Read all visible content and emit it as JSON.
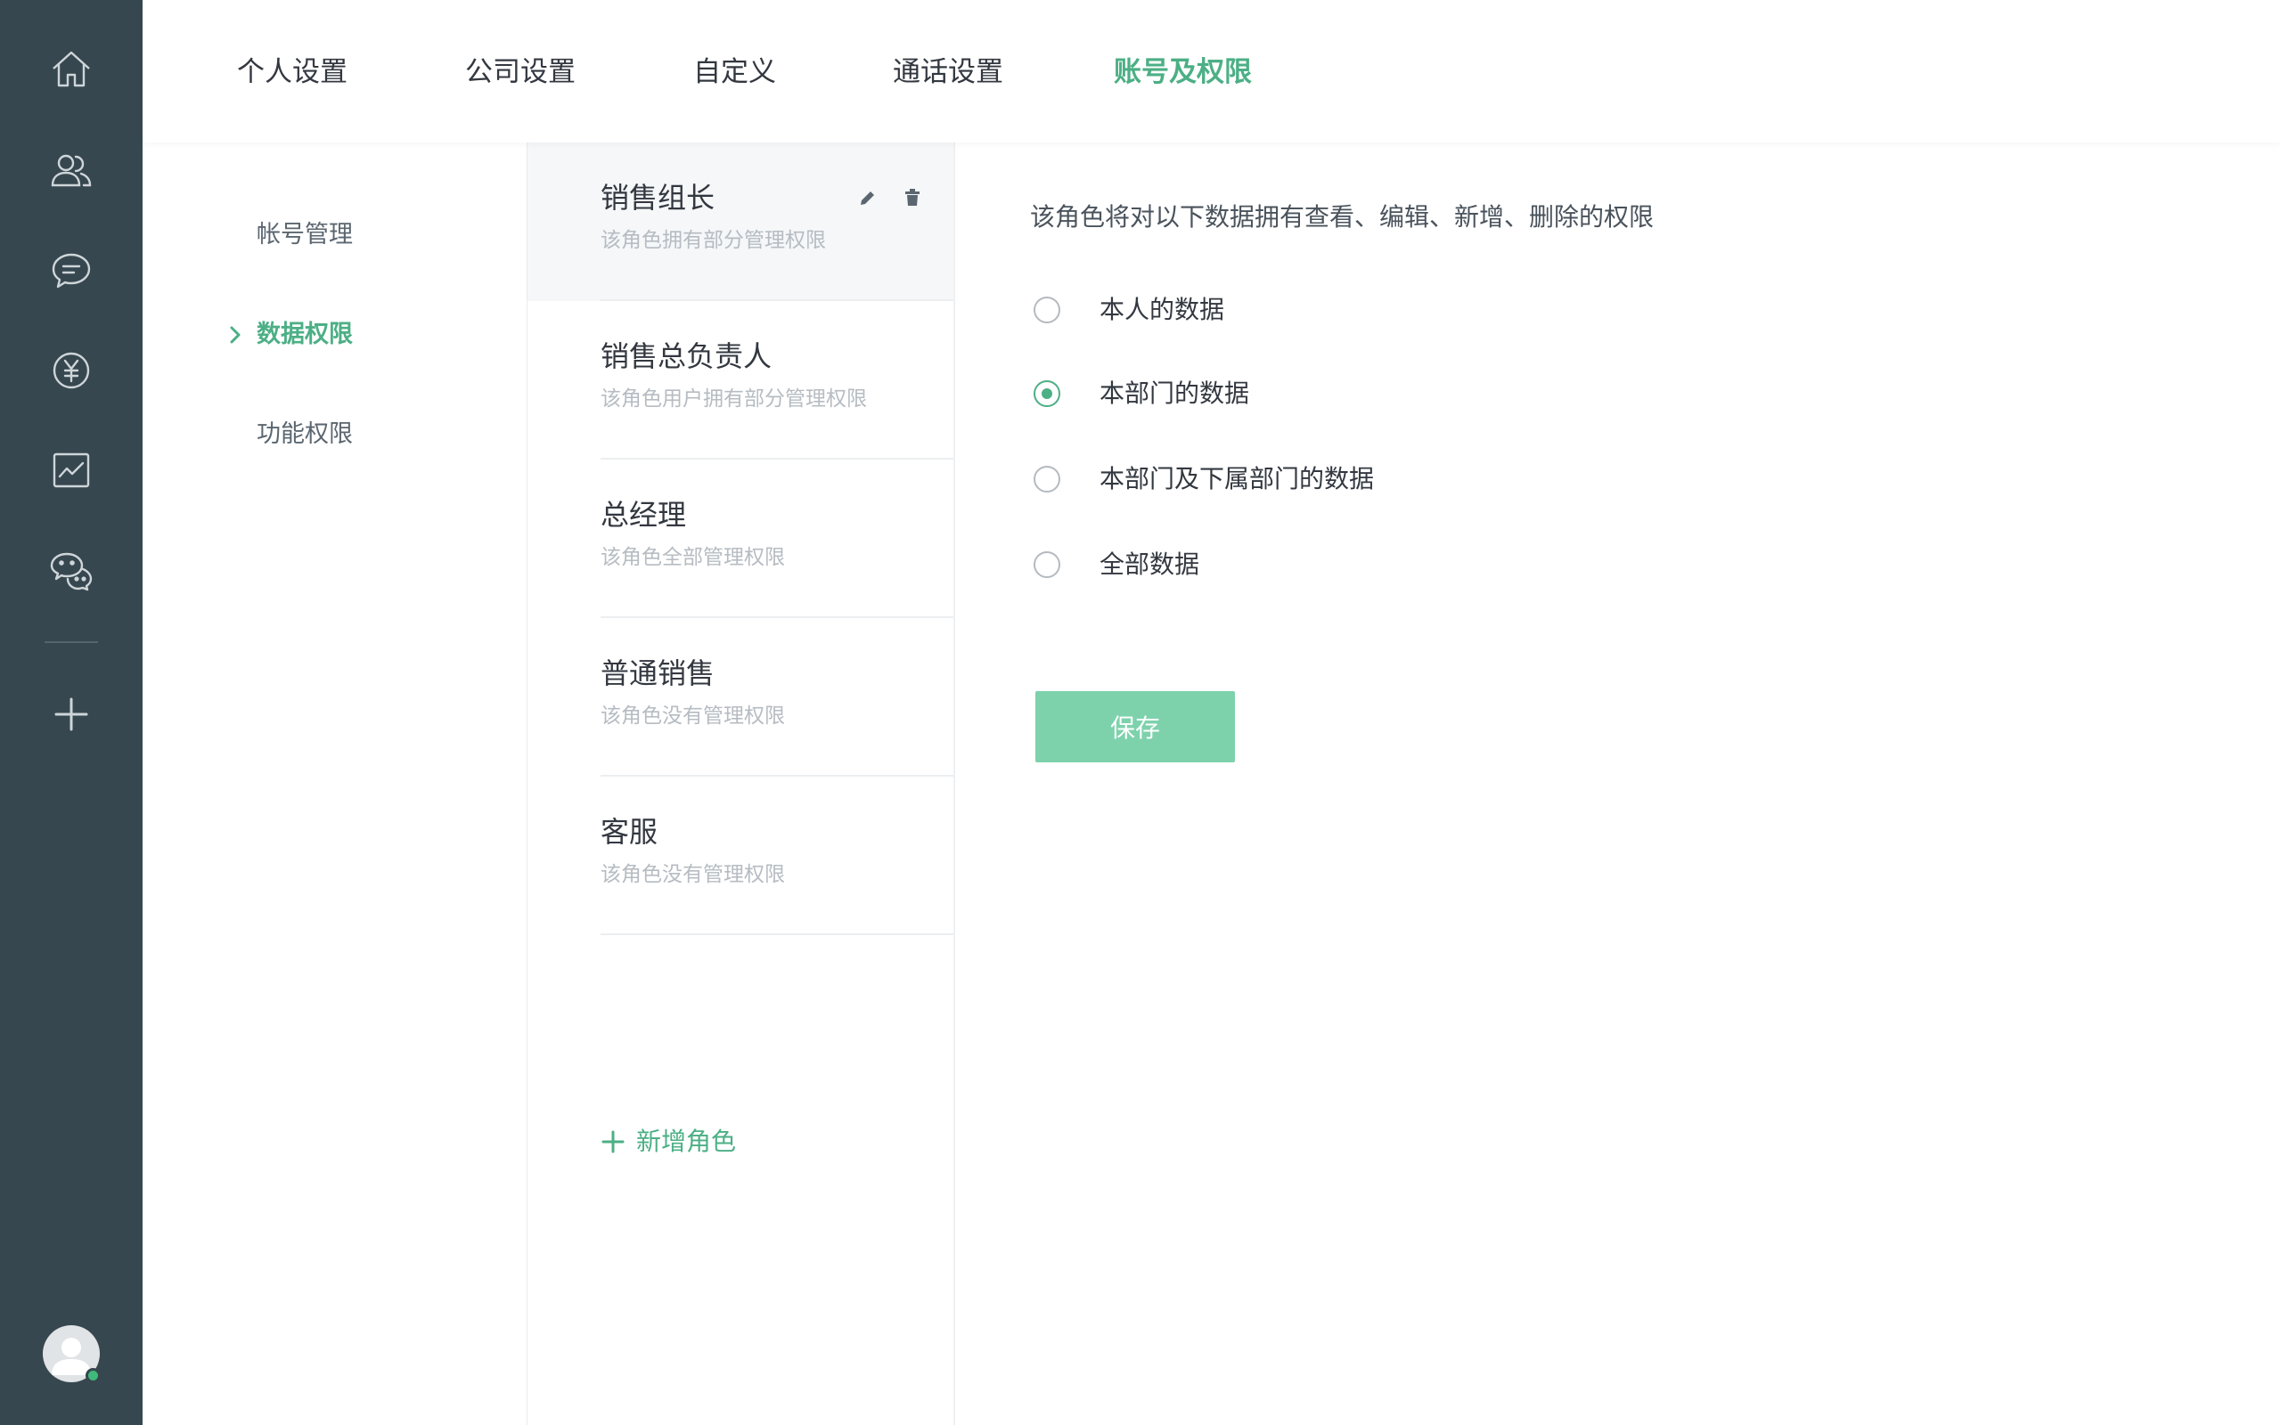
{
  "rail": {
    "icons": [
      {
        "name": "home-icon"
      },
      {
        "name": "contacts-icon"
      },
      {
        "name": "chat-icon"
      },
      {
        "name": "yuan-icon"
      },
      {
        "name": "chart-icon"
      },
      {
        "name": "wechat-icon"
      }
    ],
    "add_icon": "plus-icon",
    "avatar_status_color": "#3fba7a"
  },
  "tabs": [
    {
      "label": "个人设置"
    },
    {
      "label": "公司设置"
    },
    {
      "label": "自定义"
    },
    {
      "label": "通话设置"
    },
    {
      "label": "账号及权限",
      "active": true
    }
  ],
  "submenu": {
    "items": [
      {
        "label": "帐号管理"
      },
      {
        "label": "数据权限",
        "active": true
      },
      {
        "label": "功能权限"
      }
    ]
  },
  "roles": {
    "items": [
      {
        "name": "销售组长",
        "desc": "该角色拥有部分管理权限",
        "selected": true
      },
      {
        "name": "销售总负责人",
        "desc": "该角色用户拥有部分管理权限"
      },
      {
        "name": "总经理",
        "desc": "该角色全部管理权限"
      },
      {
        "name": "普通销售",
        "desc": "该角色没有管理权限"
      },
      {
        "name": "客服",
        "desc": "该角色没有管理权限"
      }
    ],
    "add_label": "新增角色"
  },
  "panel": {
    "description": "该角色将对以下数据拥有查看、编辑、新增、删除的权限",
    "options": [
      {
        "label": "本人的数据",
        "checked": false
      },
      {
        "label": "本部门的数据",
        "checked": true
      },
      {
        "label": "本部门及下属部门的数据",
        "checked": false
      },
      {
        "label": "全部数据",
        "checked": false
      }
    ],
    "save_label": "保存"
  },
  "colors": {
    "accent": "#4caf85",
    "rail_bg": "#37474f",
    "save_button": "#7dd2ac"
  }
}
